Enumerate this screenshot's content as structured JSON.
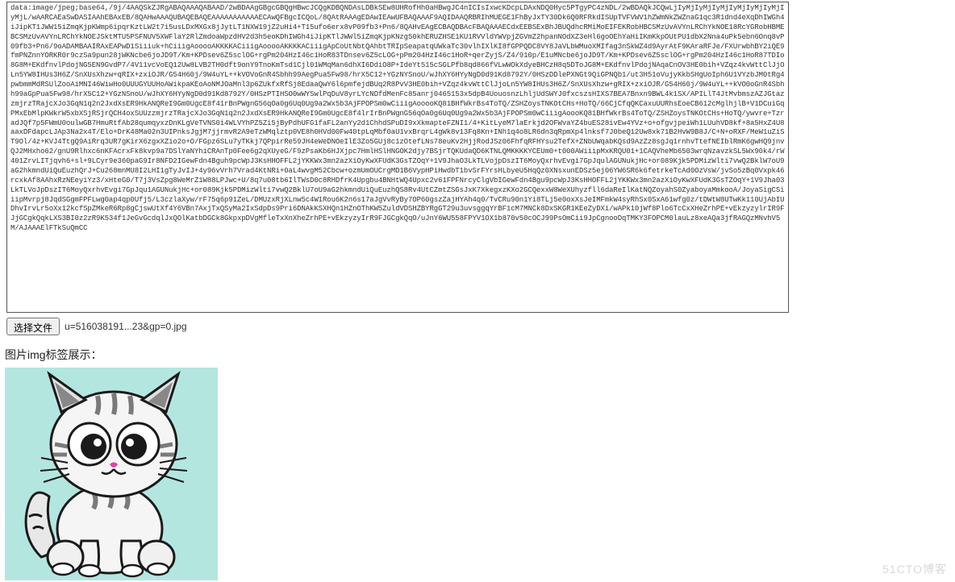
{
  "upload": {
    "button_label": "选择文件",
    "filename": "u=516038191...23&gp=0.jpg",
    "base64_content": "data:image/jpeg;base64,/9j/4AAQSkZJRgABAQAAAQABAAD/2wBDAAgGBgcGBQgHBwcJCQgKDBQNDAsLDBkSEw8UHRofHh0aHBwgJC4nICIsIxwcKDcpLDAxNDQ0Hyc5PTgyPC4zNDL/2wBDAQkJCQwLjIyMjIyMjIyMjIyMjIyMjIyMjIyMjL/wAARCAEaSwDASIAAhEBAxEB/8QAHwAAAQUBAQEBAQEAAAAAAAAAAAECAwQFBgcICQoL/8QAtRAAAgEDAwIEAwUFBAQAAAF9AQIDAAQRBRIhMUEGE1FhByJxTY30Dk6Q0RFRkdISUpTVFVWV1hZWmNkZWZnaG1qc3R1dnd4eXqDhIWGh4iJipKT1JWW15iZmqKjpKWmp6ipqrKztLW2t7i5usLDxMXGx8jJytLT1NXW19jZ2uHi4+T15ufo6erx8vP09fb3+Pn6/8QAHvEAgECBAQDBAcFBAQAAAECdxEEBSExBhJBUQdhcRMiMoEIFEKRobHBCSMzUvAVYnLRChYkNOE18RcYGRobHBMEBCSMzUvAVYnLRChYkNOEJSktMTU5PSFNUV5XWFlaY2RlZmdoaWpzdHV2d3h5eoKDhIWGh4iJipKTlJWWl5iZmqKjpKNzg50khERUZHSE1KU1RVVldYWVpjZGVmZ2hpanNOdXZ3eHl6goOEhYaHiIKmKkpOUtPU1dbX2Nna4uPk5ebn6Onq8vP09fb3+Pn6/9oADAMBAAIRAxEAPwD1Siiiuk+hCiiigAooooAKKKKACiiigAooooAKKKKACiiigApCoUtNbtQAhbtTRIpSeapatqUWkaTc30vlhIXlKI8fGPPQDC8VY8JaVLbWMuoXMIfag3nSkWZ4d9AyrAtF9KAraRFJe/FXUrwbhBY2iQE9fmPNZnnYORKR0r9czSa9pun28jWKNcbe6joJD9T/Km+KPDsev6Z5sclOG+rgPm204HzI46c1HoR83TDnsev6Z5cLOG+pPm204HzI46c1HoR+qerZyjS/Z4/910p/E1uMNcbe6joJD9T/Km+KPDsev6Z5sclOG+rgPm204HzI46c1HoR87TDIo8G8M+EKdfnvlPdojNG5EN9GvdP7/4V11vcVoEQ12Uw8LVB2TH0dft9onY9TnoKmTsd1Cjl01WMqMan6dhXI6DdiO8P+IdeYt515cSGLPfb8qd866fVLwWOkXdyeBHCzH8q5DToJG8M+EKdfnvlPdojNAqaCnOV3HE0bih+VZqz4kvWttClJjOLn5YW8IHUs3H6Z/SnXUsXhzw+qRIX+zxiOJR/G54H60j/9W4uYL++kVOVoGnR4Sbhh99AegPua5Fw98/hrX5C12+YGzNYSnoU/wJhXY6HYyNgD0d91Kd8792Y/0HSzDDlePXNGt9QiGPNQb1/ut3H51oVujyKkbSHgUoIph6U1VYzbJM0tRg4pwbmmMdRSUlZooAiMNI46WiwHo0UUUGYUUHoAWikpaKEoAoNMJOaMnl3p6ZUkfxRfSj8EdaaQwY6l6pmfejdBUq2R8PvV3HE0bih+VZqz4kvWttClJjoLn5YW8IHUs3H6Z/SnXUsXhzw+gRIX+zxiOJR/G54H60j/9W4uYL++kVO0oGnR4Sbhh99aGpPua5Fw98/hrX5C12+YGzNSnoU/wJhXY6HYyNgD0d91Kd8792Y/0HSzPTIHSO0wWYSwlPqDuV8yrLYcNDfdMenFc85anrj0465153x5dpB4UouosnzLhljUdSWYJ0fxcszsHIXS7BEA7Bnxn9BWL4k1SX/APILlT4JtMvbmszAZJGtazzmjrzTRajcXJo3GqN1q2n2JxdXsER9HkANQReI9Gm0UgcE8f41rBnPWgnG56qOa0g6Uq0Ug9a2Wx5b3AjFPOPSm0wCiiigAooooKQ81BHfWkrBs4ToTQ/ZSHZoysTNKOtCHs+HoTQ/66CjCfqQKCaxuUURhsEoeCB612cMglhjlB+V1DCuiGqPMxEbMlpKWkrW5xbXSjRSjrQCH4oxSUUzzmjrzTRajcXJo3GqN1q2n2JxdXsER9HkANQReI9Gm0UgcE8f4lrIrBnPWgnG56qOa0g6Uq0Ug9a2Wx5b3AjFPOPSm0wCiiigAoooKQ81BHfWkrBs4ToTQ/ZSHZoysTNKOtCHs+HoTQ/ywvre+TzradJQf7p5FWmU0oulwGB7HmuRtfAb28qumqyxzDnKLgVeTVNS0i4WLVYhPZ5Zi5jByPdhUFG1faFL2anYy2d1ChhdSPuDI9xXkmapteFZNI1/4+KitLyeM7laErkjd2OFWvaYZ4buES28ivEw4YVz+o+ofgvjpeiWh1LUuhVD8kf+8a5HxZ4U8aaxDFdapcLJAp3Na2x4T/Elo+DrK48Ma02n3UIPnksJgjM7jjrmvR2A9eTzWMqlztp0VE8h0HVd00Fw40tpLqMbf0aU1vxBrqrL4gWk8v13Fq8Kn+INh1q4o8LR6dn3qRpmXp4lnksf7J0beQ12Uw8xk71B2HvW9B8J/C+N+oRXF/MeW1uZiST9Ol/4z+KVJ4TtgQ9AiRrq3UR7gKirX6zgxXZio2o+O/FGpz6SLu7yTKkj7QPpirRe59JH4eWeDNOeIlE3Zo5GUj8c1zOtefLNs78euKv2HjjRodJSz06FhfqRFHYsu2TefX+ZNbUWqabKQsd9AzZz8sgJq1rnhvTtefNEIblRmK6gwHQ9jnvQJ2MHxho62/gnU9Rlhxc6nKFAcrxFk8kvp9a7DSlYaNYhiCRAnTp0Fee6g2qXUyeG/F9zPsaKb6HJXjpc7HmlHSlHNGOK2djy7BSjrTQKUdaQD6KTNLQMKKKKYCEUm0+t000AWiiipMxKRQU01+1CAQVheMb6503wrqNzavzkSL5Wx90k4/rW401ZrvLITjqvh6+sl+9LCyr9e360paG9Ir8NFD2IGewFdn4Bguh9pcWpJ3KsHHOFFL2jYKKWx3mn2azXiOyKwXFUdK3GsTZOqY+1V9JhaO3LkTLVojpDszIT6MoyQxrhvEvgi7GpJqulAGUNukjHc+or089Kjk5PDMizWlti7vwQ2BklW7oU9aG2hkmndUiQuEuzhQrJ+Cu268mnMU8I2LHI1gTyJvIJ+4y96vVrh7Vrad4KtNRi+0aL4wvgM52Cbcw+ozmUmOUCrgMD1B6VypHPiHwdbT1bvSrFYrsHLbyeU5HqQz0XNsxunEDSz5ej06YW6SR6k6fetrkeTcAd0OzVsW/jvSo5zBq0Vxpk46rcxkAf8AAhxRzNEeyiYz3/xHteG0/T7j3VsZpg8WeMrZ1W88LPJwc+U/8q7u08tb6IlTWsD0c8RHDfrK4Upgbu4BNHtWQ4Upxc2v61FPFNrcyClgVbIGewFdn4Bgu9pcWpJ3KsHHOFFL2jYKKWx3mn2azXiOyKwXFUdK3GsTZOqY+1V9Jha03LkTLVoJpDszIT6MoyQxrhvEvgi7GpJqu1AGUNukjHc+or089Kjk5PDMizWlti7vwQ2BklU7oU9aG2hkmndUiQuEuzhQS8Rv4UtCZmtZSGsJxK7XkegxzKXo2GCQexxW8WeXUhyzfll6daReIlKatNQZoyahS0ZyaboyaMmkooA/JoyaSigCSiiipMvrpj8JqdSGgmFPFLwg0ap4qp0Ufj5/L3czlaXyw/rF75q6p91ZeL/DMUzxRjXLnw5c4W1Rou6K2n6s17aJgVvRyBy7OP60gszZajHYAh4q0/TvCRu90n1Yi8TLj5e0oxXsJeIMFmkW4syRhSx0SxA61wfg0z/tDWtW8UTwKk110UjAbIUDhvIrvLr5oXx12kcfSpZMkeR6Rp8gCjswUtXf4Y6VBn7AxjTxQSyMa2IxSdpDs9Pri6DNAkKSXHQn1HZnOThKW5ZuldVDSHZBYRgGT29u3uvsggqYrBF1cM7MNCk8DxSKGR1KEeZyDXi/wAPk10jWf8Plo6TcCxXHeZrhPE+vEkzyzylrIR9FJjGCgkQqkLXS3BI0z2zR9K534f1JeGvGcdqlJxQOlKatbDGCk8GkpxpDVgMfleTxXnXheZrhPE+vEkzyzyIrR9FJGCgkQqO/uJnY6WU558FPYV1OX1b870v50cOCJ99PsOmCii9JpCgnooDqTMKY3FOPCM0lauLz8xeAQa3jfRAGQzMNvhV5M/AJAAAElFTkSuQmCC"
  },
  "section": {
    "img_label": "图片img标签展示："
  },
  "watermark": {
    "text": "51CTO博客"
  },
  "image_alt": "cat-illustration"
}
